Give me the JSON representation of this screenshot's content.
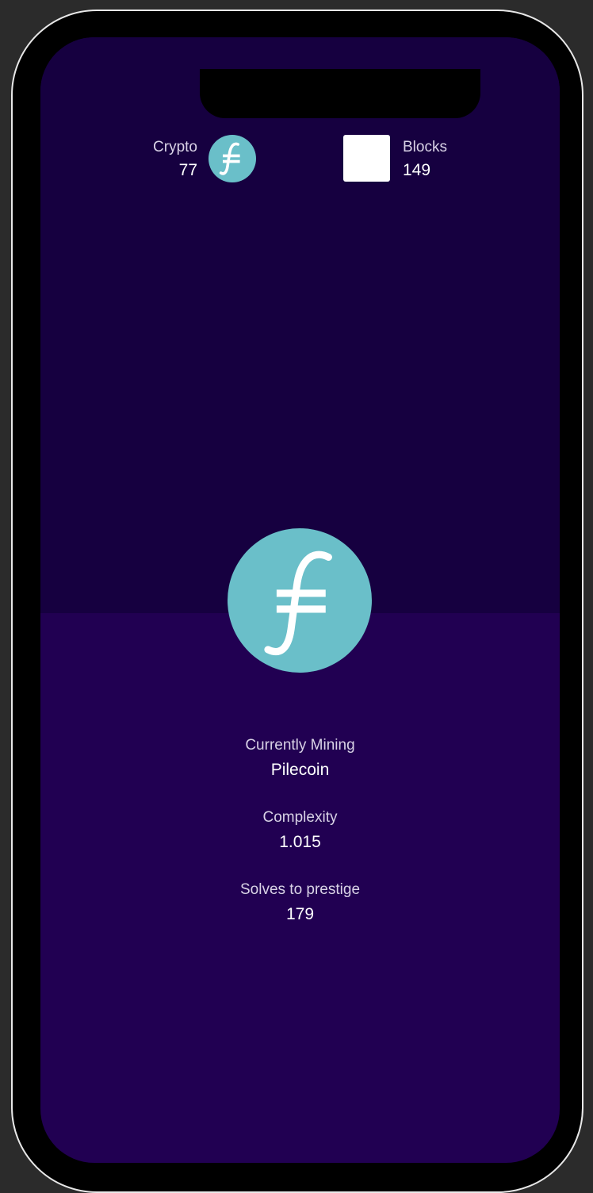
{
  "header": {
    "crypto": {
      "label": "Crypto",
      "value": "77",
      "icon": "filecoin-icon"
    },
    "blocks": {
      "label": "Blocks",
      "value": "149",
      "icon": "block-icon"
    }
  },
  "main": {
    "coin": {
      "icon": "filecoin-icon"
    },
    "currently_mining": {
      "label": "Currently Mining",
      "value": "Pilecoin"
    },
    "complexity": {
      "label": "Complexity",
      "value": "1.015"
    },
    "solves_to_prestige": {
      "label": "Solves to prestige",
      "value": "179"
    }
  },
  "colors": {
    "screen_top": "#160040",
    "screen_bottom": "#210052",
    "coin": "#6abfc9",
    "label_text": "#d9d2e6",
    "value_text": "#ffffff"
  }
}
